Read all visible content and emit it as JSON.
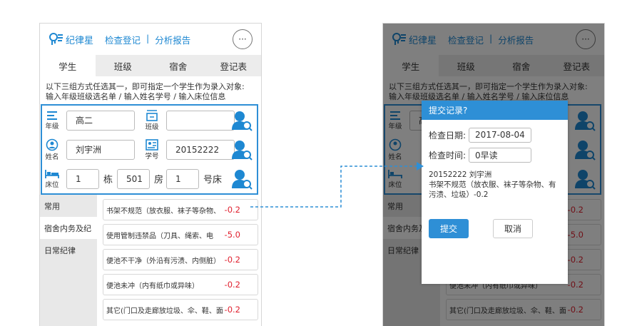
{
  "app": {
    "name": "纪律星",
    "nav_check": "检查登记",
    "nav_sep": "|",
    "nav_analysis": "分析报告",
    "more": "···"
  },
  "tabs": [
    "学生",
    "班级",
    "宿舍",
    "登记表"
  ],
  "info": {
    "line1": "以下三组方式任选其一，即可指定一个学生作为录入对象:",
    "line2": "输入年级班级选名单 / 输入姓名学号 / 输入床位信息"
  },
  "form": {
    "grade_label": "年级",
    "grade_value": "高二",
    "class_label": "班级",
    "class_value": "",
    "name_label": "姓名",
    "name_value": "刘宇洲",
    "id_label": "学号",
    "id_value": "20152222",
    "bed_label": "床位",
    "building_value": "1",
    "building_unit": "栋",
    "room_value": "501",
    "room_unit": "房",
    "bed_value": "1",
    "bed_unit": "号床"
  },
  "categories": [
    "常用",
    "宿舍内务及纪",
    "日常纪律"
  ],
  "items": [
    {
      "label": "书架不规范（放衣服、袜子等杂物、",
      "score": "-0.2"
    },
    {
      "label": "使用管制违禁品（刀具、绳索、电",
      "score": "-5.0"
    },
    {
      "label": "便池不干净（外沿有污渍、内侧脏）",
      "score": "-0.2"
    },
    {
      "label": "便池未冲（内有纸巾或异味）",
      "score": "-0.2"
    },
    {
      "label": "其它(门口及走廊放垃圾、伞、鞋、面",
      "score": "-0.2"
    }
  ],
  "dialog": {
    "title": "提交记录?",
    "date_label": "检查日期:",
    "date_value": "2017-08-04",
    "time_label": "检查时间:",
    "time_value": "0早读",
    "student": "20152222 刘宇洲",
    "desc": "书架不规范（放衣服、袜子等杂物、有污渍、垃圾）-0.2",
    "submit": "提交",
    "cancel": "取消"
  },
  "colors": {
    "accent": "#2e8fd6",
    "score": "#e0212f"
  }
}
